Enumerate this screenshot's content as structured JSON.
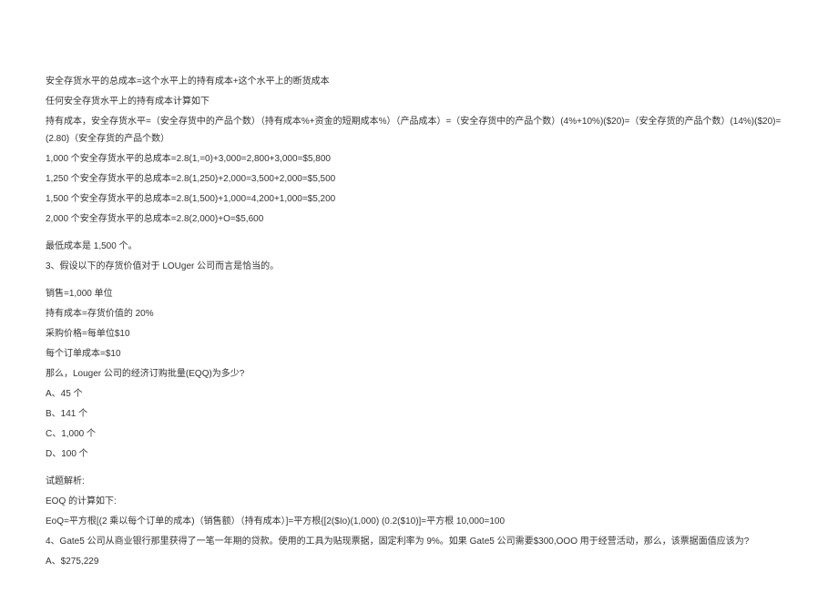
{
  "lines": [
    "安全存货水平的总成本=这个水平上的持有成本+这个水平上的断货成本",
    "任何安全存货水平上的持有成本计算如下",
    "持有成本，安全存货水平=（安全存货中的产品个数）（持有成本%+资金的短期成本%）（产品成本）=（安全存货中的产品个数）(4%+10%)($20)=（安全存货的产品个数）(14%)($20)=(2.80)（安全存货的产品个数）",
    "1,000 个安全存货水平的总成本=2.8(1,=0)+3,000=2,800+3,000=$5,800",
    "1,250 个安全存货水平的总成本=2.8(1,250)+2,000=3,500+2,000=$5,500",
    "1,500 个安全存货水平的总成本=2.8(1,500)+1,000=4,200+1,000=$5,200",
    "2,000 个安全存货水平的总成本=2.8(2,000)+O=$5,600",
    "",
    "最低成本是 1,500 个。",
    "3、假设以下的存货价值对于 LOUger 公司而言是恰当的。",
    "",
    "销售=1,000 单位",
    "持有成本=存货价值的 20%",
    "采购价格=每单位$10",
    "每个订单成本=$10",
    "那么，Louger 公司的经济订购批量(EQQ)为多少?",
    "A、45 个",
    "B、141 个",
    "C、1,000 个",
    "D、100 个",
    "",
    "试题解析:",
    "EOQ 的计算如下:",
    "EoQ=平方根[(2 乘以每个订单的成本)（销售额）（持有成本）]=平方根{[2($Io)(1,000)         (0.2($10)]=平方根 10,000=100",
    "4、Gate5 公司从商业银行那里获得了一笔一年期的贷款。使用的工具为贴现票据，固定利率为 9%。如果 Gate5 公司需要$300,OOO 用于经营活动，那么，该票据面值应该为?",
    "A、$275,229"
  ]
}
